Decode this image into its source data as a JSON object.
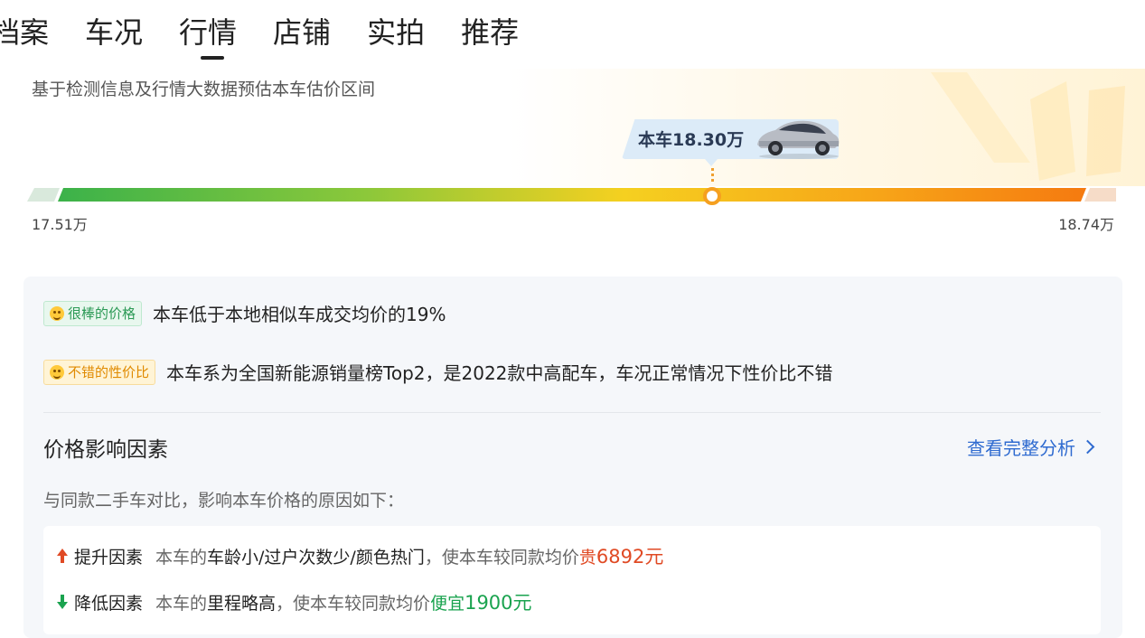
{
  "tabs": [
    {
      "label": "档案"
    },
    {
      "label": "车况"
    },
    {
      "label": "行情",
      "active": true
    },
    {
      "label": "店铺"
    },
    {
      "label": "实拍"
    },
    {
      "label": "推荐"
    }
  ],
  "estimate": {
    "description": "基于检测信息及行情大数据预估本车估价区间",
    "current_label": "本车18.30万",
    "current_value_wan": 18.3,
    "min_label": "17.51万",
    "max_label": "18.74万",
    "min_value_wan": 17.51,
    "max_value_wan": 18.74
  },
  "badges": {
    "great": {
      "label": "很棒的价格",
      "text": "本车低于本地相似车成交均价的19%"
    },
    "good": {
      "label": "不错的性价比",
      "text": "本车系为全国新能源销量榜Top2，是2022款中高配车，车况正常情况下性价比不错"
    }
  },
  "factors": {
    "title": "价格影响因素",
    "link_label": "查看完整分析",
    "description": "与同款二手车对比，影响本车价格的原因如下：",
    "up": {
      "label": "提升因素",
      "prefix": "本车的",
      "emphasis": "车龄小/过户次数少/颜色热门",
      "middle": "，使本车较同款均价",
      "result_word": "贵",
      "result_amount": "6892元"
    },
    "down": {
      "label": "降低因素",
      "prefix": "本车的",
      "emphasis": "里程略高",
      "middle": "，使本车较同款均价",
      "result_word": "便宜",
      "result_amount": "1900元"
    }
  },
  "colors": {
    "accent_blue": "#2f6bd0",
    "up_red": "#e04a24",
    "down_green": "#1aa34f",
    "bar_start": "#3bb24a",
    "bar_mid": "#f5d020",
    "bar_end": "#f57a10"
  }
}
